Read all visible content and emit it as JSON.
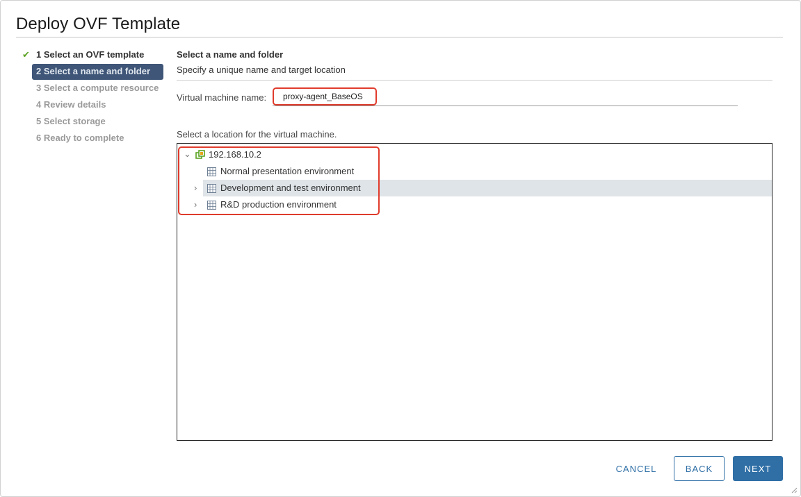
{
  "dialog": {
    "title": "Deploy OVF Template"
  },
  "steps": [
    {
      "label": "1 Select an OVF template",
      "state": "done"
    },
    {
      "label": "2 Select a name and folder",
      "state": "active"
    },
    {
      "label": "3 Select a compute resource",
      "state": "pending"
    },
    {
      "label": "4 Review details",
      "state": "pending"
    },
    {
      "label": "5 Select storage",
      "state": "pending"
    },
    {
      "label": "6 Ready to complete",
      "state": "pending"
    }
  ],
  "section": {
    "title": "Select a name and folder",
    "subtitle": "Specify a unique name and target location"
  },
  "vm_name": {
    "label": "Virtual machine name:",
    "value": "proxy-agent_BaseOS"
  },
  "location": {
    "label": "Select a location for the virtual machine.",
    "tree": [
      {
        "label": "192.168.10.2",
        "icon": "datacenter-icon",
        "expanded": true
      },
      {
        "label": "Normal presentation environment",
        "icon": "folder-icon",
        "expandable": false
      },
      {
        "label": "Development and test environment",
        "icon": "folder-icon",
        "expandable": true,
        "selected": true
      },
      {
        "label": "R&D production environment",
        "icon": "folder-icon",
        "expandable": true
      }
    ]
  },
  "buttons": {
    "cancel": "CANCEL",
    "back": "BACK",
    "next": "NEXT"
  },
  "colors": {
    "accent": "#2f6fa6",
    "active_step": "#3f5678",
    "highlight": "#e03b2c",
    "check": "#5aa220"
  }
}
